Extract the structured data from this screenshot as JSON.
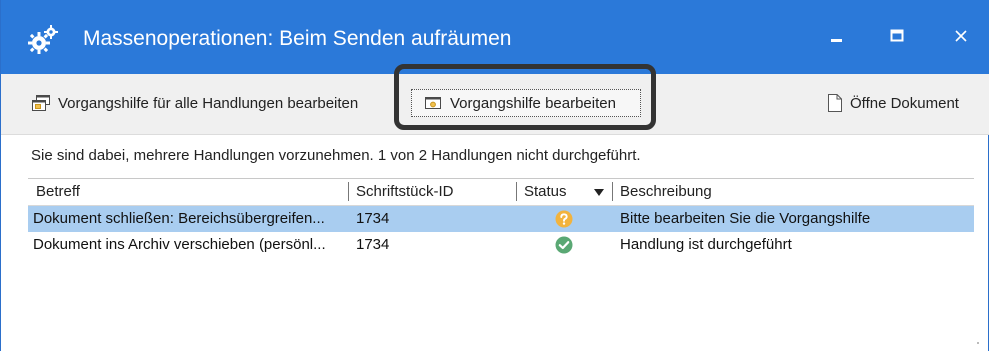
{
  "window": {
    "title": "Massenoperationen: Beim Senden aufräumen",
    "title_bar_color": "#2b79d9",
    "buttons": {
      "minimize": "minimize",
      "maximize": "maximize",
      "close": "close"
    }
  },
  "toolbar": {
    "edit_all_label": "Vorgangshilfe für alle Handlungen bearbeiten",
    "edit_label": "Vorgangshilfe bearbeiten",
    "open_label": "Öffne Dokument"
  },
  "message": "Sie sind dabei, mehrere Handlungen vorzunehmen. 1 von 2 Handlungen nicht durchgeführt.",
  "grid": {
    "columns": [
      "Betreff",
      "Schriftstück-ID",
      "Status",
      "Beschreibung"
    ],
    "sort_column": "Status",
    "selection_color": "#a9cdf0",
    "rows": [
      {
        "betreff": "Dokument schließen: Bereichsübergreifen...",
        "id": "1734",
        "status": "pending",
        "status_icon": "question-circle-icon",
        "status_color": "#f2b33d",
        "beschreibung": "Bitte bearbeiten Sie die Vorgangshilfe",
        "selected": true
      },
      {
        "betreff": "Dokument ins Archiv verschieben (persönl...",
        "id": "1734",
        "status": "done",
        "status_icon": "check-circle-icon",
        "status_color": "#5aa874",
        "beschreibung": "Handlung ist durchgeführt",
        "selected": false
      }
    ]
  }
}
